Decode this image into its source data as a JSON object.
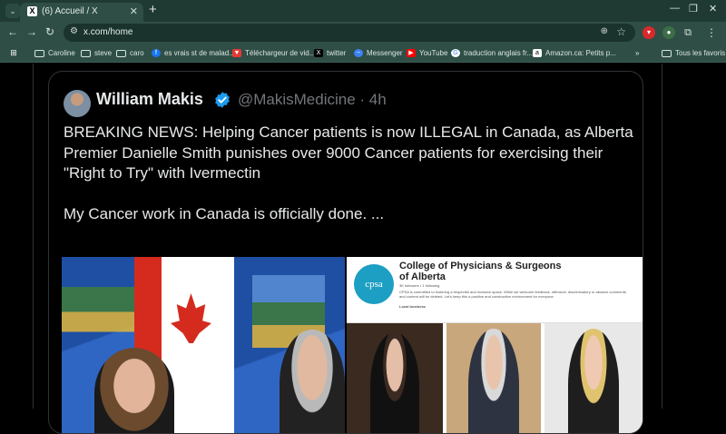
{
  "browser": {
    "tab_title": "(6) Accueil / X",
    "tab_favicon": "X",
    "url": "x.com/home",
    "bookmarks": [
      {
        "label": "Caroline",
        "icon": "folder-icon"
      },
      {
        "label": "steve",
        "icon": "folder-icon"
      },
      {
        "label": "caro",
        "icon": "folder-icon"
      },
      {
        "label": "es vrais st de malad...",
        "icon": "facebook-icon"
      },
      {
        "label": "Téléchargeur de vid...",
        "icon": "downloader-icon"
      },
      {
        "label": "twitter",
        "icon": "x-icon"
      },
      {
        "label": "Messenger",
        "icon": "messenger-icon"
      },
      {
        "label": "YouTube",
        "icon": "youtube-icon"
      },
      {
        "label": "traduction anglais fr...",
        "icon": "google-icon"
      },
      {
        "label": "Amazon.ca: Petits p...",
        "icon": "amazon-icon"
      }
    ],
    "all_bookmarks_label": "Tous les favoris"
  },
  "tweet": {
    "author_name": "William Makis",
    "handle_time": "@MakisMedicine · 4h",
    "text_line1": "BREAKING NEWS: Helping Cancer patients is now ILLEGAL in Canada, as Alberta Premier Danielle Smith punishes over 9000 Cancer patients for exercising their \"Right to Try\" with Ivermectin",
    "text_line2": "My Cancer work in Canada is officially done. ..."
  },
  "media_right": {
    "logo_text": "cpsa",
    "title": "College of Physicians & Surgeons of Alberta",
    "followers": "3K followers • 1 following",
    "description": "CPSA is committed to fostering a respectful and inclusive space. While we welcome feedback, offensive, discriminatory or abusive comments and content will be deleted. Let's keep this a positive and constructive environment for everyone.",
    "category": "Local business"
  },
  "colors": {
    "chrome_bg": "#2f4f46",
    "tabstrip_bg": "#1f3a33",
    "verified_blue": "#1d9bf0",
    "page_bg": "#000000",
    "text_primary": "#e7e9ea",
    "text_secondary": "#71767b"
  }
}
